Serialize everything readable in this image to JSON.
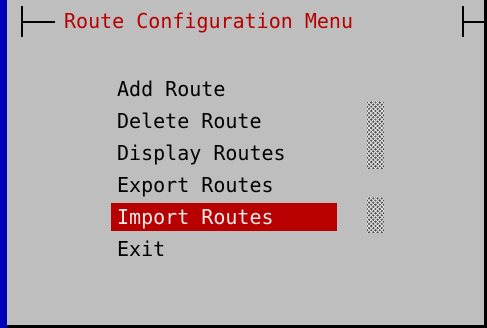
{
  "dialog": {
    "title": "Route Configuration Menu",
    "items": [
      {
        "label": "Add Route"
      },
      {
        "label": "Delete Route"
      },
      {
        "label": "Display Routes"
      },
      {
        "label": "Export Routes"
      },
      {
        "label": "Import Routes",
        "selected": true
      },
      {
        "label": "Exit"
      }
    ]
  },
  "colors": {
    "background": "#0000b8",
    "dialog": "#bebebe",
    "title": "#b80000",
    "highlight": "#b80000",
    "highlight_text": "#e8e8e8"
  }
}
